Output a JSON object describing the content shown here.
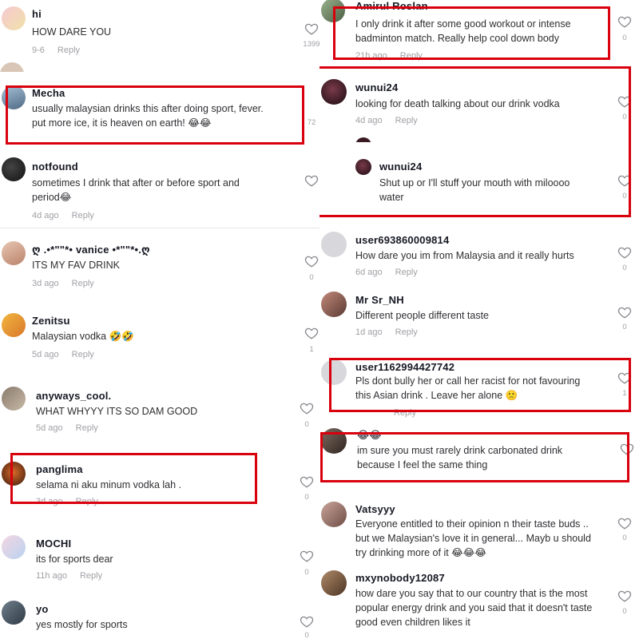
{
  "reply_label": "Reply",
  "colors": {
    "highlight": "#d9000d",
    "username": "#161823",
    "muted": "#a0a0a6"
  },
  "icons": {
    "like": "heart-outline-icon"
  },
  "left": {
    "comments": [
      {
        "user": "hi",
        "text": "HOW DARE YOU",
        "date": "9-6",
        "likes": "1399"
      },
      {
        "user": "Mecha",
        "text": "usually malaysian drinks this after doing sport, fever.\nput more ice, it is heaven on earth! 😂😂",
        "date": "",
        "likes": "72"
      },
      {
        "user": "notfound",
        "text": "sometimes I drink that after or before sport and\nperiod😂",
        "date": "4d ago",
        "likes": ""
      },
      {
        "user": "ღ .•*\"\"*• vanice •*\"\"*•.ღ",
        "text": "ITS MY FAV DRINK",
        "date": "3d ago",
        "likes": "0"
      },
      {
        "user": "Zenitsu",
        "text": "Malaysian vodka 🤣🤣",
        "date": "5d ago",
        "likes": "1"
      },
      {
        "user": "anyways_cool.",
        "text": "WHAT WHYYY ITS SO DAM GOOD",
        "date": "5d ago",
        "likes": "0"
      },
      {
        "user": "panglima",
        "text": "selama ni aku minum vodka lah .",
        "date": "3d ago",
        "likes": "0"
      },
      {
        "user": "MOCHI",
        "text": "its for sports dear",
        "date": "11h ago",
        "likes": "0"
      },
      {
        "user": "yo",
        "text": "yes mostly for sports",
        "date": "",
        "likes": "0"
      }
    ]
  },
  "right": {
    "comments": [
      {
        "user": "Amirul Roslan",
        "text": "I only drink it after some good workout or intense\nbadminton match. Really help cool down body",
        "date": "21h ago",
        "likes": "0"
      },
      {
        "user": "wunui24",
        "text": "looking for death talking about our drink vodka",
        "date": "4d ago",
        "likes": "0"
      },
      {
        "user": "wunui24",
        "text": "Shut up or I'll stuff your mouth with miloooo\nwater",
        "date": "",
        "likes": "0"
      },
      {
        "user": "user693860009814",
        "text": "How dare you im from Malaysia and it really hurts",
        "date": "6d ago",
        "likes": "0"
      },
      {
        "user": "Mr Sr_NH",
        "text": "Different people different taste",
        "date": "1d ago",
        "likes": "0"
      },
      {
        "user": "user1162994427742",
        "text": "Pls dont bully her or call her racist for not favouring\nthis Asian drink . Leave her alone 🙁",
        "date": "",
        "likes": "1"
      },
      {
        "user": "😂😂",
        "text": "im sure you must rarely drink carbonated drink\nbecause I feel the same thing",
        "date": "",
        "likes": ""
      },
      {
        "user": "Vatsyyy",
        "text": "Everyone entitled to their opinion n their taste buds ..\nbut we Malaysian's love it in general... Mayb u should\ntry drinking more of it 😂😂😂",
        "date": "",
        "likes": "0"
      },
      {
        "user": "mxynobody12087",
        "text": "how dare you say that to our country that is the most\npopular energy drink and you said that it doesn't taste\ngood even children likes it",
        "date": "",
        "likes": "0"
      }
    ]
  }
}
